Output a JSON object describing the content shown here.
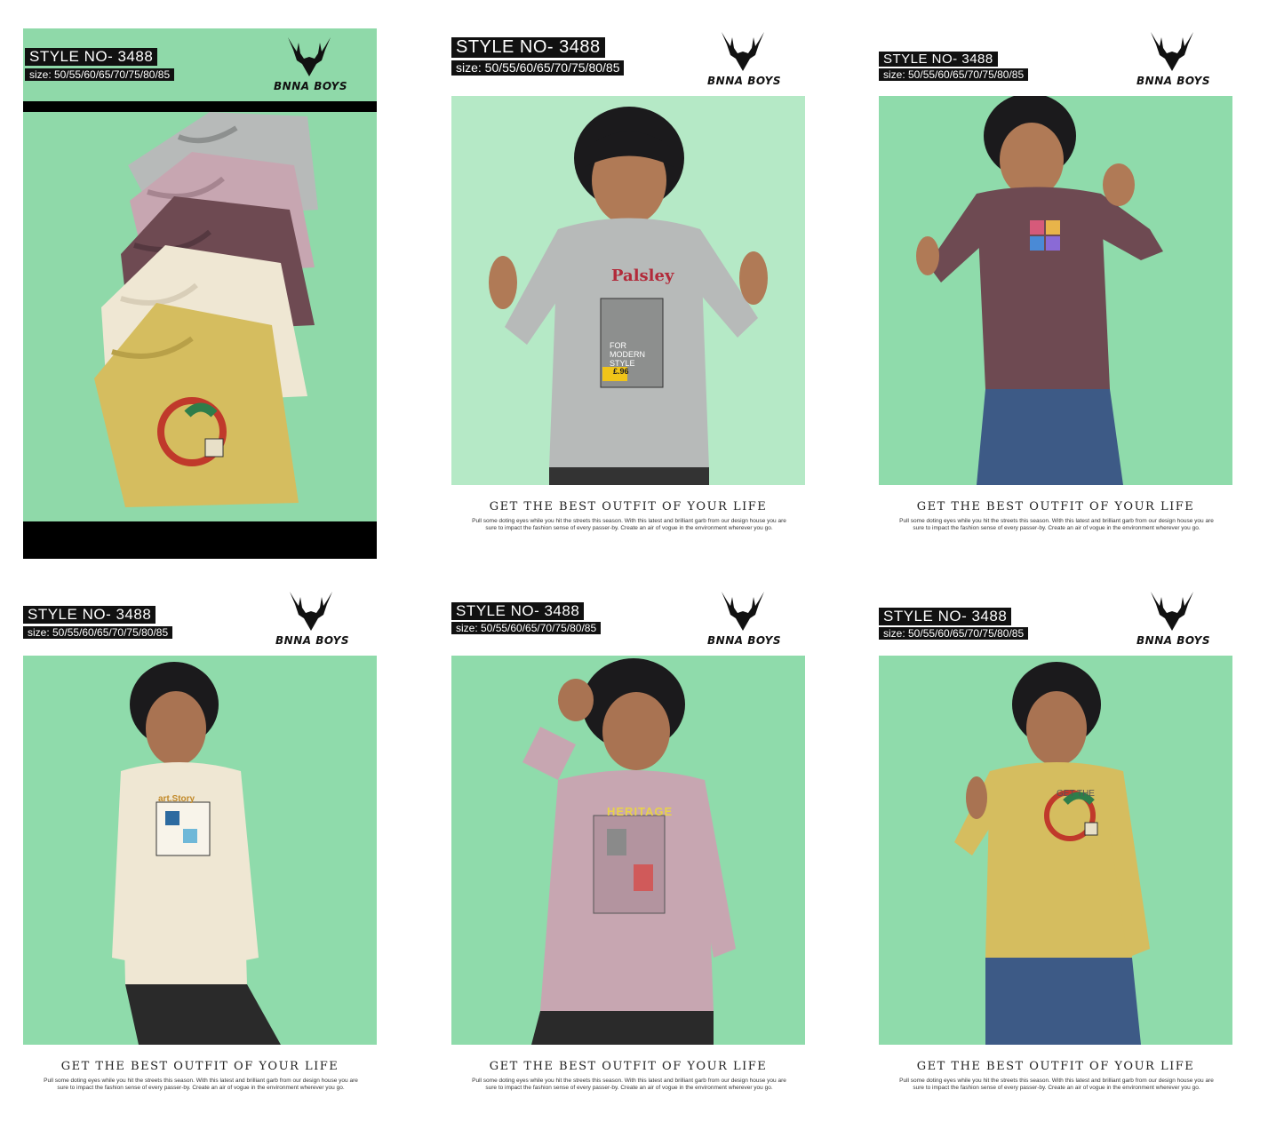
{
  "style_no": "STYLE NO- 3488",
  "size": "size: 50/55/60/65/70/75/80/85",
  "brand": "BNNA BOYS",
  "tagline": "GET THE BEST OUTFIT OF YOUR LIFE",
  "description": "Pull some doting eyes while you hit the streets this season. With this latest and brilliant garb from our design house you are sure to impact the fashion sense of every passer-by.  Create an air of vogue in the environment wherever you go.",
  "colors": {
    "backdrop": "#8fdbab",
    "grey": "#b7bab9",
    "mauve": "#c7a6b1",
    "maroon": "#6e4a52",
    "cream": "#efe7d3",
    "mustard": "#d5bd5f"
  },
  "shirt_prints": {
    "grey": "Palsley",
    "grey_sub": "FOR MODERN STYLE",
    "grey_price": "£.96",
    "cream": "art.Story",
    "mauve": "HERITAGE",
    "mustard": "GET THE"
  },
  "icons": {
    "logo": "deer-antler-icon"
  }
}
